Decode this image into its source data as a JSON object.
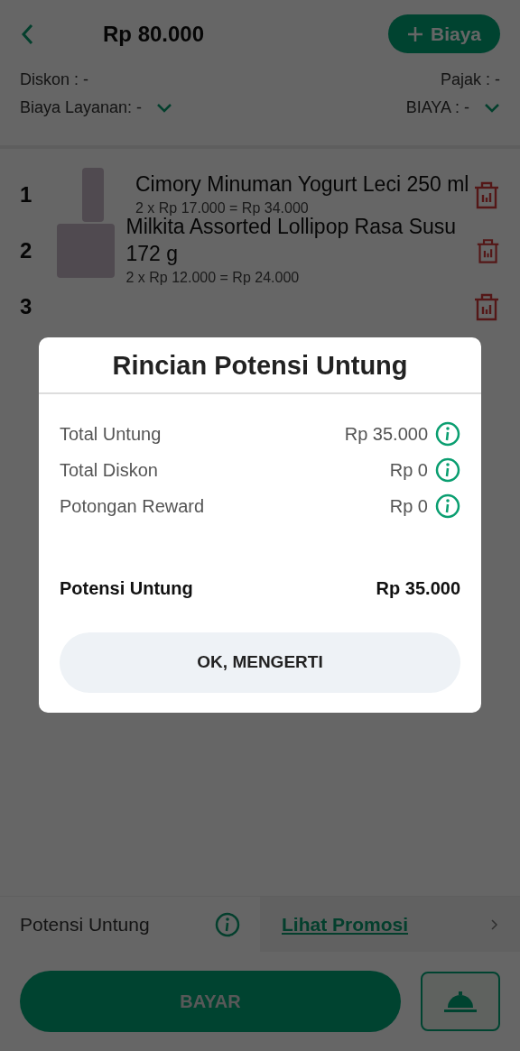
{
  "header": {
    "total": "Rp 80.000",
    "add_button": "Biaya"
  },
  "summary": {
    "discount": "Diskon : -",
    "tax": "Pajak : -",
    "service_fee": "Biaya Layanan: -",
    "fee": "BIAYA : -"
  },
  "items": [
    {
      "number": "1",
      "name": "Cimory Minuman Yogurt Leci 250 ml",
      "detail": "2 x Rp 17.000 = Rp 34.000"
    },
    {
      "number": "2",
      "name": "Milkita Assorted Lollipop Rasa Susu 172 g",
      "detail": "2 x Rp 12.000 = Rp 24.000"
    },
    {
      "number": "3"
    }
  ],
  "footer": {
    "profit_label": "Potensi Untung",
    "promo_link": "Lihat Promosi",
    "pay_button": "BAYAR"
  },
  "dialog": {
    "title": "Rincian Potensi Untung",
    "rows": [
      {
        "label": "Total Untung",
        "value": "Rp 35.000"
      },
      {
        "label": "Total Diskon",
        "value": "Rp 0"
      },
      {
        "label": "Potongan Reward",
        "value": "Rp 0"
      }
    ],
    "total_label": "Potensi Untung",
    "total_value": "Rp 35.000",
    "ok_button": "OK, MENGERTI"
  }
}
